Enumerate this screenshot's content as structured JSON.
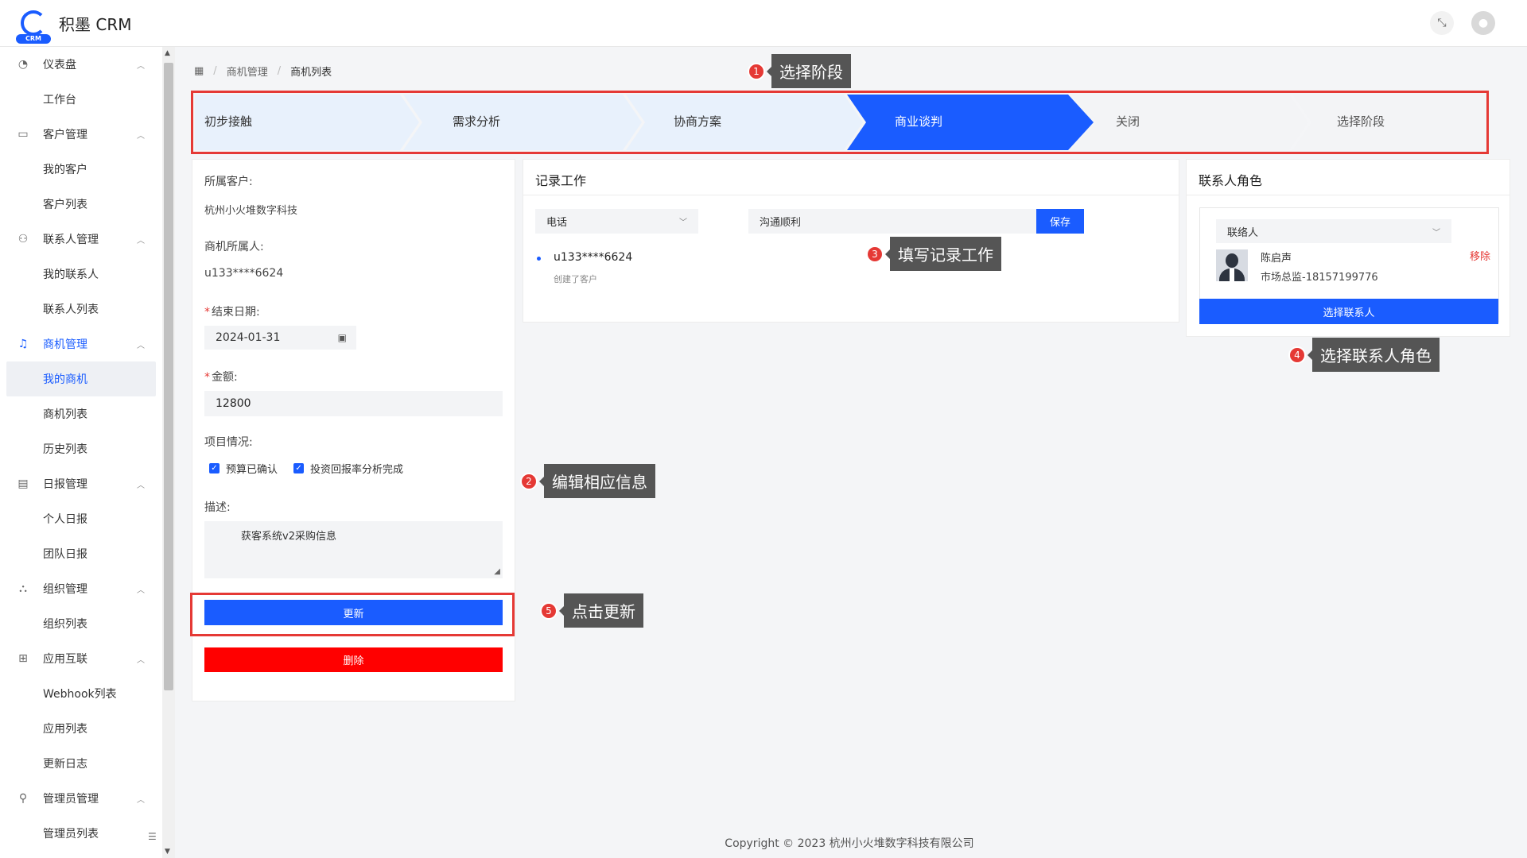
{
  "app": {
    "title": "积墨 CRM",
    "logo_badge": "CRM"
  },
  "header": {
    "fullscreen_icon": "fullscreen-exit-icon",
    "avatar_icon": "user-avatar-icon"
  },
  "sidebar": {
    "groups": [
      {
        "label": "仪表盘",
        "icon": "dashboard-icon",
        "items": [
          "工作台"
        ]
      },
      {
        "label": "客户管理",
        "icon": "customer-icon",
        "items": [
          "我的客户",
          "客户列表"
        ]
      },
      {
        "label": "联系人管理",
        "icon": "contacts-icon",
        "items": [
          "我的联系人",
          "联系人列表"
        ]
      },
      {
        "label": "商机管理",
        "icon": "bell-icon",
        "items": [
          "我的商机",
          "商机列表",
          "历史列表"
        ]
      },
      {
        "label": "日报管理",
        "icon": "calendar-icon",
        "items": [
          "个人日报",
          "团队日报"
        ]
      },
      {
        "label": "组织管理",
        "icon": "org-icon",
        "items": [
          "组织列表"
        ]
      },
      {
        "label": "应用互联",
        "icon": "apps-icon",
        "items": [
          "Webhook列表",
          "应用列表",
          "更新日志"
        ]
      },
      {
        "label": "管理员管理",
        "icon": "admin-icon",
        "items": [
          "管理员列表"
        ]
      }
    ],
    "active_item": "我的商机"
  },
  "breadcrumb": [
    "商机管理",
    "商机列表"
  ],
  "stages": [
    "初步接触",
    "需求分析",
    "协商方案",
    "商业谈判",
    "关闭",
    "选择阶段"
  ],
  "active_stage": "商业谈判",
  "colors": {
    "accent": "#1a5cff",
    "danger": "#ff0000",
    "annotation": "#e53935",
    "stage_done": "#e8f1fc",
    "stage_todo": "#f3f4f6"
  },
  "opportunity": {
    "customer_label": "所属客户:",
    "customer_value": "杭州小火堆数字科技",
    "owner_label": "商机所属人:",
    "owner_value": "u133****6624",
    "end_date_label": "结束日期:",
    "end_date_value": "2024-01-31",
    "amount_label": "金额:",
    "amount_value": "12800",
    "project_label": "项目情况:",
    "checks": [
      "预算已确认",
      "投资回报率分析完成"
    ],
    "desc_label": "描述:",
    "desc_value": "获客系统v2采购信息",
    "update_button": "更新",
    "delete_button": "删除"
  },
  "record": {
    "title": "记录工作",
    "type_value": "电话",
    "input_value": "沟通顺利",
    "save_button": "保存",
    "timeline": [
      {
        "user": "u133****6624",
        "action": "创建了客户"
      }
    ]
  },
  "contact_role": {
    "title": "联系人角色",
    "role_value": "联络人",
    "contact_name": "陈启声",
    "contact_meta": "市场总监-18157199776",
    "remove_label": "移除",
    "choose_button": "选择联系人"
  },
  "annotations": [
    {
      "num": "1",
      "text": "选择阶段"
    },
    {
      "num": "2",
      "text": "编辑相应信息"
    },
    {
      "num": "3",
      "text": "填写记录工作"
    },
    {
      "num": "4",
      "text": "选择联系人角色"
    },
    {
      "num": "5",
      "text": "点击更新"
    }
  ],
  "footer": "Copyright © 2023 杭州小火堆数字科技有限公司"
}
